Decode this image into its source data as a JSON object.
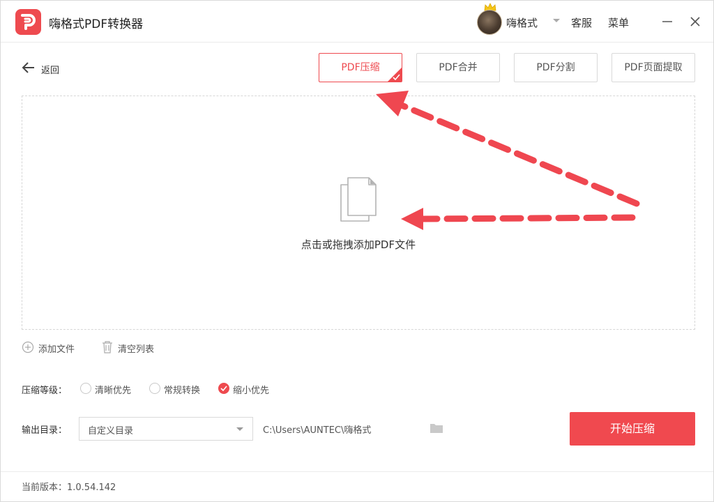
{
  "app": {
    "title": "嗨格式PDF转换器"
  },
  "header": {
    "username": "嗨格式",
    "service": "客服",
    "menu": "菜单"
  },
  "nav": {
    "back": "返回"
  },
  "tabs": [
    {
      "label": "PDF压缩",
      "active": true
    },
    {
      "label": "PDF合并",
      "active": false
    },
    {
      "label": "PDF分割",
      "active": false
    },
    {
      "label": "PDF页面提取",
      "active": false
    }
  ],
  "dropzone": {
    "label": "点击或拖拽添加PDF文件"
  },
  "file_actions": {
    "add": "添加文件",
    "clear": "清空列表"
  },
  "compression": {
    "label": "压缩等级：",
    "options": [
      {
        "label": "清晰优先",
        "selected": false
      },
      {
        "label": "常规转换",
        "selected": false
      },
      {
        "label": "缩小优先",
        "selected": true
      }
    ]
  },
  "output": {
    "label": "输出目录：",
    "select_value": "自定义目录",
    "path": "C:\\Users\\AUNTEC\\嗨格式"
  },
  "start_button": "开始压缩",
  "footer": {
    "version": "当前版本：1.0.54.142"
  },
  "colors": {
    "accent": "#ee4a4f",
    "annotation": "#ef4750"
  }
}
